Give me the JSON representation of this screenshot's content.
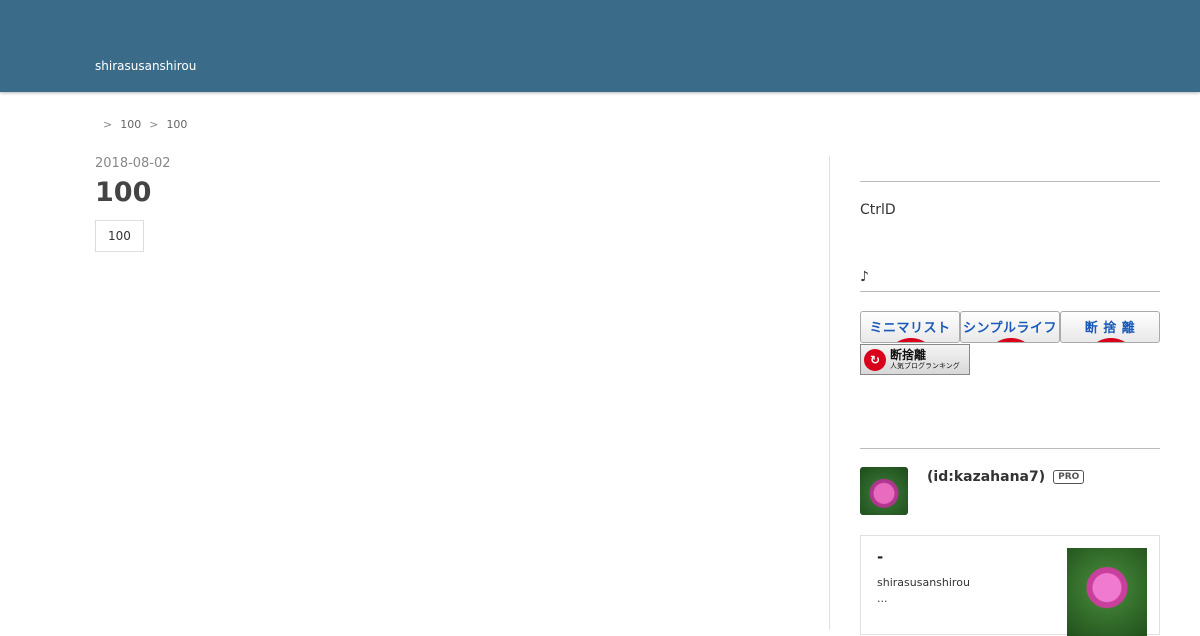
{
  "header": {
    "blog_title": "shirasusanshirou"
  },
  "breadcrumb": {
    "sep1": ">",
    "item1": "100",
    "sep2": ">",
    "item2": "100"
  },
  "entry": {
    "date": "2018-08-02",
    "title": "100",
    "category": "100"
  },
  "sidebar": {
    "ctrl_text": "CtrlD",
    "note_text": "♪",
    "banners": [
      {
        "label": "ミニマリスト"
      },
      {
        "label": "シンプルライフ"
      },
      {
        "label": "断 捨 離"
      }
    ],
    "ranking_banner": {
      "title": "断捨離",
      "subtitle": "人気ブログランキング"
    },
    "profile": {
      "name": "(id:kazahana7)",
      "badge": "PRO"
    },
    "card": {
      "title": "-",
      "subtitle": "shirasusanshirou",
      "ellipsis": "..."
    }
  },
  "colors": {
    "header_bg": "#3a6c8a",
    "banner_text": "#1a5ab8",
    "banner_red": "#d9001b"
  }
}
